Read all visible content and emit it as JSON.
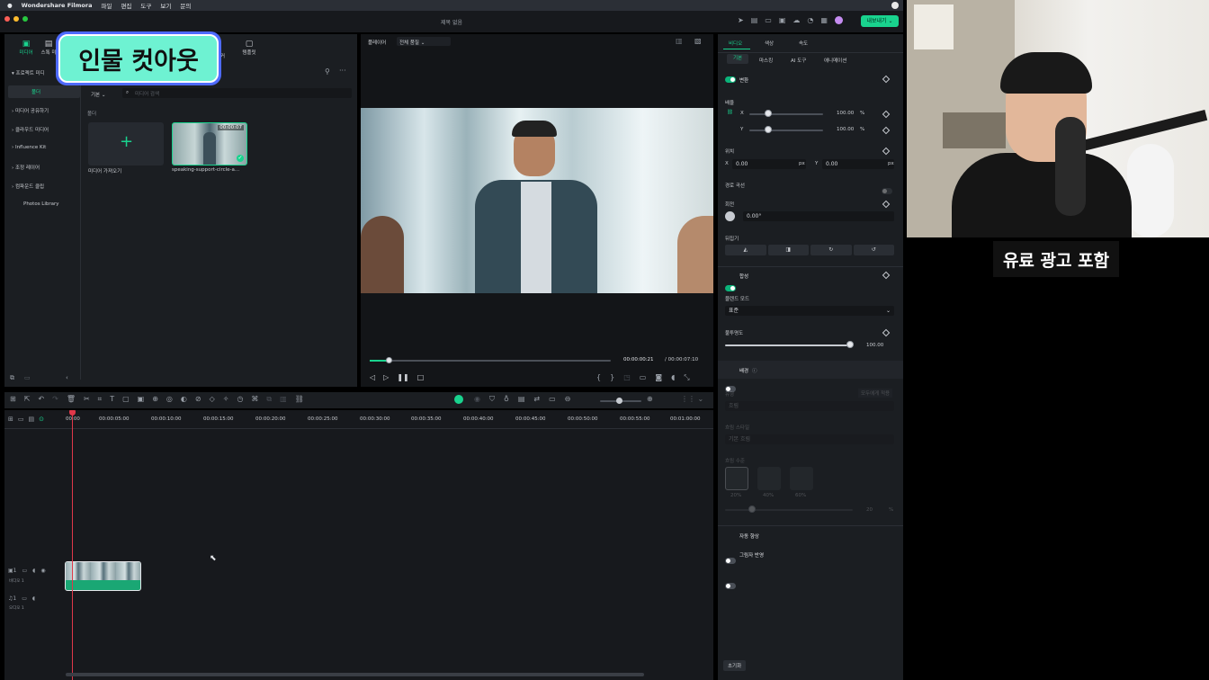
{
  "menubar": {
    "app": "Wondershare Filmora",
    "items": [
      "파일",
      "편집",
      "도구",
      "보기",
      "문의"
    ]
  },
  "window": {
    "title": "제목 없음",
    "export_label": "내보내기"
  },
  "left_tabs": [
    {
      "label": "미디어"
    },
    {
      "label": "스톡 미"
    },
    {
      "label": "템플릿"
    }
  ],
  "left_tab_partial": "커",
  "overlay": {
    "caption": "인물 컷아웃",
    "ad_caption": "유료 광고 포함"
  },
  "media": {
    "sidebar": [
      "프로젝트 미디",
      "폴더",
      "미디어 공유하기",
      "클라우드 미디어",
      "Influence Kit",
      "조정 레이어",
      "컴파운드 클립",
      "Photos Library"
    ],
    "sort_label": "기본",
    "search_placeholder": "미디어 검색",
    "folder_label": "폴더",
    "import_label": "미디어 가져오기",
    "clip_name": "speaking-support-circle-a...",
    "clip_duration": "00:00:07"
  },
  "player": {
    "label": "플레이어",
    "quality": "전체 품질",
    "current_time": "00:00:00:21",
    "total_time": "/ 00:00:07:10",
    "progress": 0.08
  },
  "inspector": {
    "tabs": [
      "비디오",
      "색상",
      "속도"
    ],
    "subtabs": [
      "기본",
      "마스킹",
      "AI 도구",
      "애니메이션"
    ],
    "transform": {
      "label": "변환",
      "scale_label": "배율",
      "scale_x": "100.00",
      "scale_y": "100.00",
      "unit": "%",
      "pos_label": "위치",
      "pos_x": "0.00",
      "pos_y": "0.00",
      "px": "px",
      "x": "X",
      "y": "Y"
    },
    "path_curve": "경로 곡선",
    "rotate_label": "회전",
    "rotate_value": "0.00°",
    "flip_label": "뒤집기",
    "composite_label": "합성",
    "blend_label": "블렌드 모드",
    "blend_value": "표준",
    "opacity_label": "불투명도",
    "opacity_value": "100.00",
    "bg_label": "배경",
    "bg_type_label": "유형",
    "bg_apply_all": "모두에게 적용",
    "bg_type_value": "흐림",
    "blur_style_label": "흐림 스타일",
    "blur_style_value": "기본 흐림",
    "blur_level_label": "흐림 수준",
    "blur_levels": [
      "20%",
      "40%",
      "60%"
    ],
    "blur_value": "20",
    "auto_enhance": "자동 향상",
    "drop_shadow": "그림자 반영",
    "reset": "초기화"
  },
  "timeline": {
    "ruler": [
      "00:00",
      "00:00:05:00",
      "00:00:10:00",
      "00:00:15:00",
      "00:00:20:00",
      "00:00:25:00",
      "00:00:30:00",
      "00:00:35:00",
      "00:00:40:00",
      "00:00:45:00",
      "00:00:50:00",
      "00:00:55:00",
      "00:01:00:00"
    ],
    "video_track": "비디오 1",
    "audio_track": "오디오 1"
  },
  "colors": {
    "accent": "#0bb37a",
    "playhead": "#e0384a",
    "caption_border": "#4f6bff"
  }
}
